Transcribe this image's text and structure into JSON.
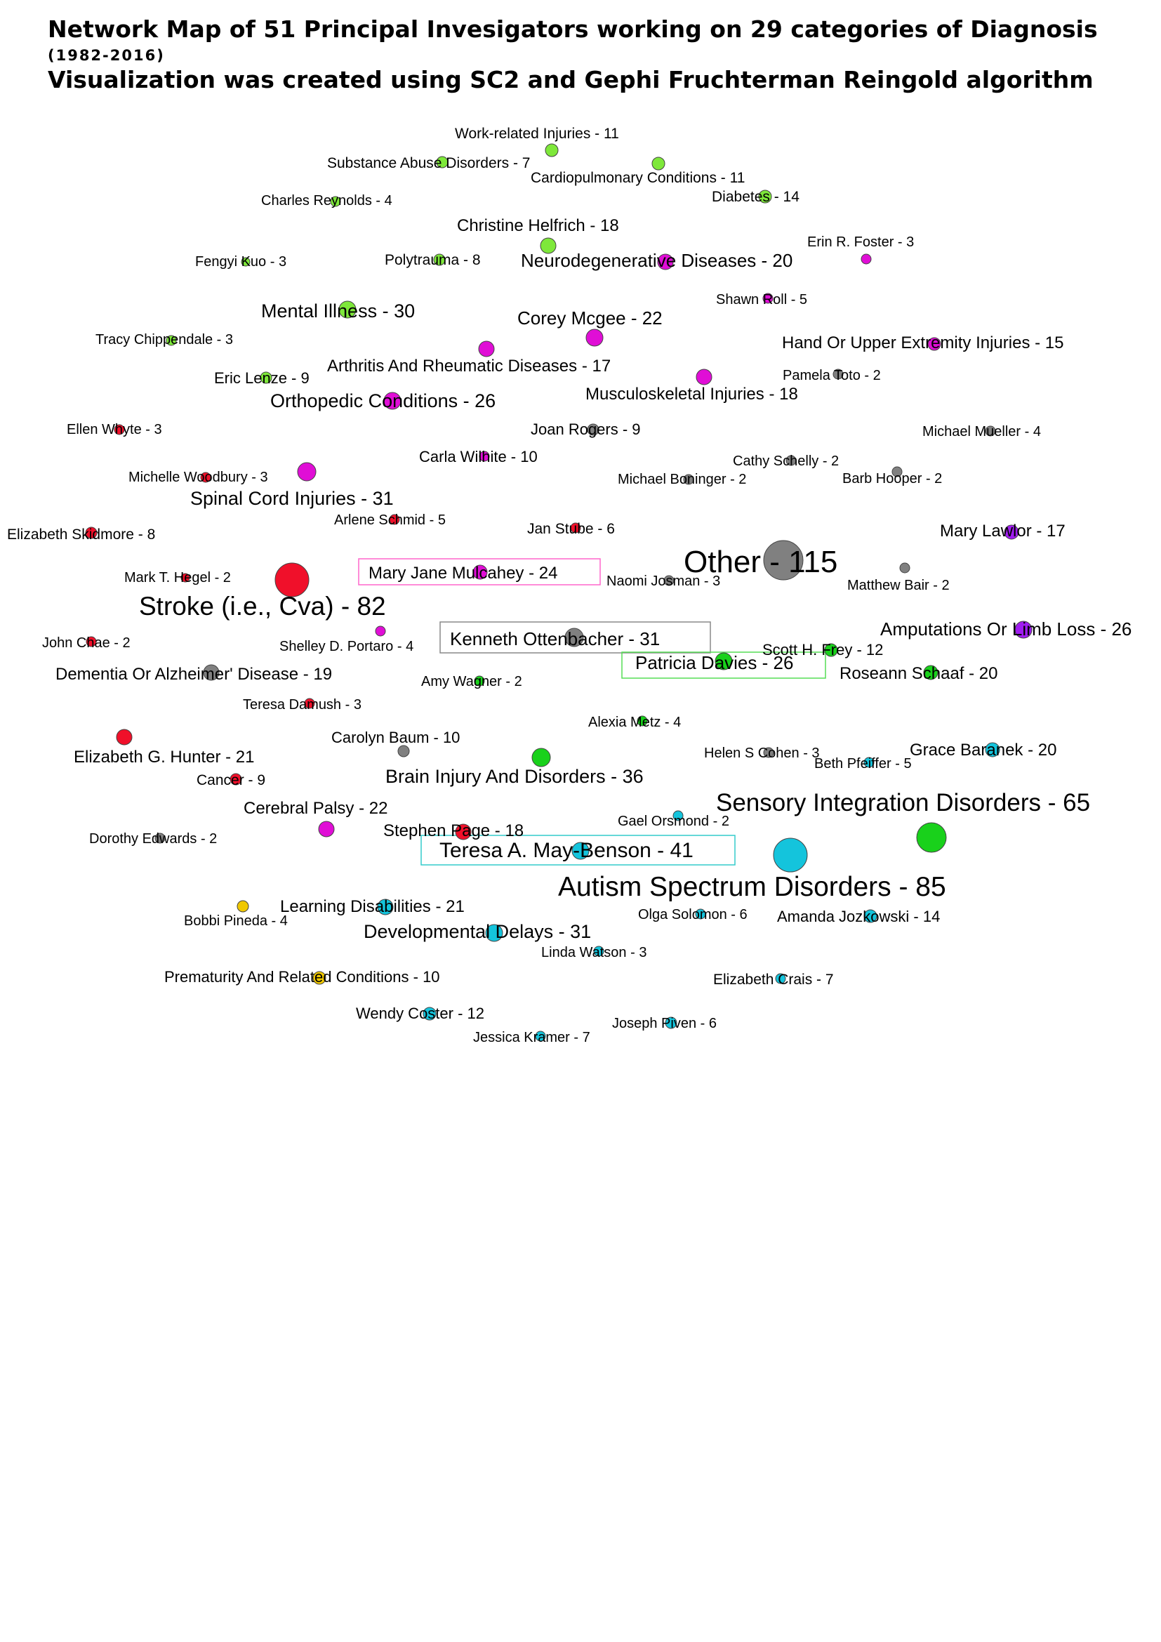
{
  "title": {
    "line1": "Network Map of 51 Principal Invesigators working on 29 categories of Diagnosis",
    "line2": "(1982-2016)",
    "line3": "Visualization was created using SC2 and Gephi Fruchterman Reingold algorithm"
  },
  "colors": {
    "lime": "#7ee83a",
    "green": "#19d11b",
    "magenta": "#e00ed6",
    "red": "#f0102a",
    "gray": "#808080",
    "purple": "#a01cf0",
    "cyan": "#14c4dc",
    "yellow": "#f0c800",
    "pink_box": "#ff66cc",
    "gray_box": "#888888",
    "green_box": "#55dd55",
    "cyan_box": "#33cccc"
  },
  "nodes": [
    {
      "label": "Work-related Injuries - 11",
      "color": "lime"
    },
    {
      "label": "Substance Abuse Disorders - 7",
      "color": "lime"
    },
    {
      "label": "Cardiopulmonary Conditions  - 11",
      "color": "lime"
    },
    {
      "label": "Charles Reynolds - 4",
      "color": "lime"
    },
    {
      "label": "Diabetes - 14",
      "color": "lime"
    },
    {
      "label": "Christine Helfrich - 18",
      "color": "lime"
    },
    {
      "label": "Erin R. Foster - 3",
      "color": "magenta"
    },
    {
      "label": "Fengyi Kuo - 3",
      "color": "lime"
    },
    {
      "label": "Polytrauma - 8",
      "color": "lime"
    },
    {
      "label": "Neurodegenerative Diseases - 20",
      "color": "magenta"
    },
    {
      "label": "Shawn Roll - 5",
      "color": "magenta"
    },
    {
      "label": "Mental Illness - 30",
      "color": "lime"
    },
    {
      "label": "Corey Mcgee - 22",
      "color": "magenta"
    },
    {
      "label": "Tracy Chippendale - 3",
      "color": "lime"
    },
    {
      "label": "Hand Or Upper Extremity Injuries - 15",
      "color": "magenta"
    },
    {
      "label": "Arthritis And Rheumatic Diseases - 17",
      "color": "magenta"
    },
    {
      "label": "Eric Lenze - 9",
      "color": "lime"
    },
    {
      "label": "Pamela Toto - 2",
      "color": "gray"
    },
    {
      "label": "Orthopedic Conditions - 26",
      "color": "magenta"
    },
    {
      "label": "Musculoskeletal Injuries - 18",
      "color": "magenta"
    },
    {
      "label": "Ellen Whyte - 3",
      "color": "red"
    },
    {
      "label": "Joan Rogers - 9",
      "color": "gray"
    },
    {
      "label": "Michael Mueller - 4",
      "color": "gray"
    },
    {
      "label": "Carla Wilhite - 10",
      "color": "magenta"
    },
    {
      "label": "Cathy Schelly - 2",
      "color": "gray"
    },
    {
      "label": "Michelle Woodbury - 3",
      "color": "red"
    },
    {
      "label": "Michael Boninger - 2",
      "color": "gray"
    },
    {
      "label": "Barb Hooper - 2",
      "color": "gray"
    },
    {
      "label": "Spinal Cord Injuries - 31",
      "color": "magenta"
    },
    {
      "label": "Arlene Schmid - 5",
      "color": "red"
    },
    {
      "label": "Elizabeth Skidmore - 8",
      "color": "red"
    },
    {
      "label": "Jan Stube - 6",
      "color": "red"
    },
    {
      "label": "Mary Lawlor - 17",
      "color": "purple"
    },
    {
      "label": "Other - 115",
      "color": "gray"
    },
    {
      "label": "Mary Jane Mulcahey - 24",
      "color": "magenta"
    },
    {
      "label": "Mark T. Hegel - 2",
      "color": "red"
    },
    {
      "label": "Naomi Josman - 3",
      "color": "gray"
    },
    {
      "label": "Matthew Bair - 2",
      "color": "gray"
    },
    {
      "label": "Stroke (i.e., Cva) - 82",
      "color": "red"
    },
    {
      "label": "Amputations Or Limb Loss - 26",
      "color": "purple"
    },
    {
      "label": "John Chae - 2",
      "color": "red"
    },
    {
      "label": "Shelley D. Portaro - 4",
      "color": "magenta"
    },
    {
      "label": "Kenneth Ottenbacher - 31",
      "color": "gray"
    },
    {
      "label": "Scott H. Frey - 12",
      "color": "green"
    },
    {
      "label": "Patricia Davies - 26",
      "color": "green"
    },
    {
      "label": "Dementia Or Alzheimer' Disease - 19",
      "color": "gray"
    },
    {
      "label": "Amy Wagner - 2",
      "color": "green"
    },
    {
      "label": "Roseann Schaaf - 20",
      "color": "green"
    },
    {
      "label": "Teresa Damush - 3",
      "color": "red"
    },
    {
      "label": "Alexia Metz - 4",
      "color": "green"
    },
    {
      "label": "Carolyn Baum - 10",
      "color": "gray"
    },
    {
      "label": "Elizabeth G. Hunter - 21",
      "color": "red"
    },
    {
      "label": "Helen S Cohen - 3",
      "color": "gray"
    },
    {
      "label": "Grace Baranek - 20",
      "color": "cyan"
    },
    {
      "label": "Beth Pfeiffer - 5",
      "color": "cyan"
    },
    {
      "label": "Brain Injury And Disorders - 36",
      "color": "green"
    },
    {
      "label": "Cancer - 9",
      "color": "red"
    },
    {
      "label": "Cerebral Palsy - 22",
      "color": "magenta"
    },
    {
      "label": "Sensory Integration Disorders - 65",
      "color": "green"
    },
    {
      "label": "Gael Orsmond - 2",
      "color": "cyan"
    },
    {
      "label": "Stephen Page - 18",
      "color": "red"
    },
    {
      "label": "Dorothy Edwards - 2",
      "color": "gray"
    },
    {
      "label": "Teresa A. May-Benson - 41",
      "color": "cyan"
    },
    {
      "label": "Autism Spectrum Disorders - 85",
      "color": "cyan"
    },
    {
      "label": "Learning Disabilities - 21",
      "color": "cyan"
    },
    {
      "label": "Bobbi Pineda - 4",
      "color": "yellow"
    },
    {
      "label": "Olga Solomon - 6",
      "color": "cyan"
    },
    {
      "label": "Amanda Jozkowski - 14",
      "color": "cyan"
    },
    {
      "label": "Developmental Delays - 31",
      "color": "cyan"
    },
    {
      "label": "Linda Watson - 3",
      "color": "cyan"
    },
    {
      "label": "Prematurity And Related Conditions - 10",
      "color": "yellow"
    },
    {
      "label": "Elizabeth Crais - 7",
      "color": "cyan"
    },
    {
      "label": "Wendy Coster - 12",
      "color": "cyan"
    },
    {
      "label": "Joseph Piven - 6",
      "color": "cyan"
    },
    {
      "label": "Jessica Kramer - 7",
      "color": "cyan"
    }
  ]
}
